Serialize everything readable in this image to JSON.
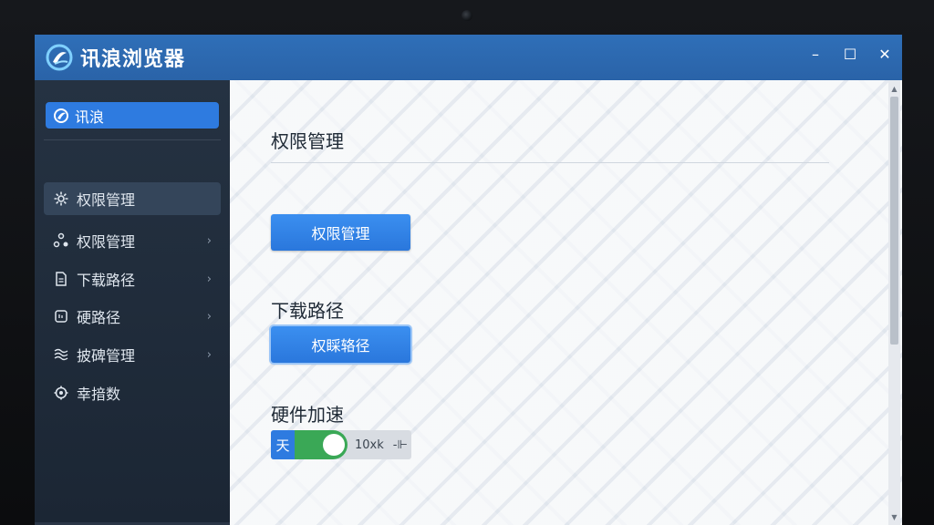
{
  "window": {
    "title": "讯浪浏览器"
  },
  "window_controls": {
    "minimize": "–",
    "maximize": "☐",
    "close": "✕"
  },
  "sidebar": {
    "brand": {
      "label": "讯浪",
      "icon": "logo-icon"
    },
    "items": [
      {
        "label": "权限管理",
        "icon": "gear-icon",
        "active": true,
        "has_chevron": false
      },
      {
        "label": "权限管理",
        "icon": "nodes-icon",
        "active": false,
        "has_chevron": true
      },
      {
        "label": "下载路径",
        "icon": "document-icon",
        "active": false,
        "has_chevron": true
      },
      {
        "label": "硬路径",
        "icon": "drive-icon",
        "active": false,
        "has_chevron": true
      },
      {
        "label": "披碑管理",
        "icon": "waves-icon",
        "active": false,
        "has_chevron": true
      },
      {
        "label": "幸揞数",
        "icon": "gear-outline-icon",
        "active": false,
        "has_chevron": false
      }
    ],
    "chevron": "›"
  },
  "main": {
    "sections": [
      {
        "title": "权限管理",
        "button": "权限管理"
      },
      {
        "title": "下载路径",
        "button": "权睬辂径"
      },
      {
        "title": "硬件加速",
        "toggle": {
          "prefix": "天",
          "value": "10xk",
          "on": true,
          "icon": "pin-icon"
        }
      }
    ]
  },
  "colors": {
    "titlebar": "#2f6fb8",
    "sidebar": "#253242",
    "accent": "#2e7be0",
    "toggle_on": "#3aa856"
  }
}
